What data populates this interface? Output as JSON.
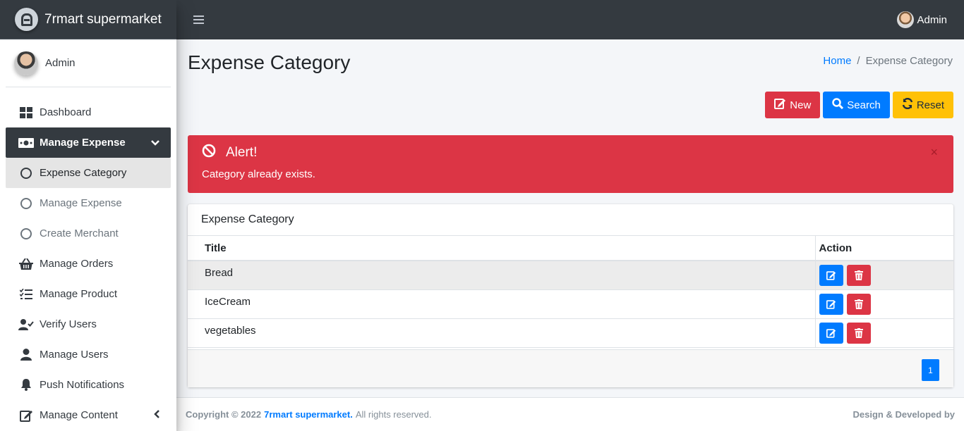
{
  "brand": {
    "name": "7rmart supermarket"
  },
  "user": {
    "name": "Admin"
  },
  "topbar": {
    "user_name": "Admin"
  },
  "sidebar": {
    "items": [
      {
        "label": "Dashboard",
        "icon": "dashboard-icon"
      },
      {
        "label": "Manage Expense",
        "icon": "money-bill-icon",
        "active": true
      },
      {
        "label": "Expense Category",
        "icon": "circle-icon",
        "sub": true,
        "current": true
      },
      {
        "label": "Manage Expense",
        "icon": "circle-icon",
        "sub": true
      },
      {
        "label": "Create Merchant",
        "icon": "circle-icon",
        "sub": true
      },
      {
        "label": "Manage Orders",
        "icon": "basket-icon"
      },
      {
        "label": "Manage Product",
        "icon": "tasks-icon"
      },
      {
        "label": "Verify Users",
        "icon": "user-check-icon"
      },
      {
        "label": "Manage Users",
        "icon": "user-icon"
      },
      {
        "label": "Push Notifications",
        "icon": "bell-icon"
      },
      {
        "label": "Manage Content",
        "icon": "edit-icon"
      }
    ]
  },
  "page": {
    "title": "Expense Category"
  },
  "breadcrumb": {
    "home": "Home",
    "separator": "/",
    "current": "Expense Category"
  },
  "actions": {
    "new_label": "New",
    "search_label": "Search",
    "reset_label": "Reset"
  },
  "alert": {
    "title": "Alert!",
    "message": "Category already exists.",
    "close": "×"
  },
  "card": {
    "title": "Expense Category",
    "columns": [
      "Title",
      "Action"
    ],
    "rows": [
      "Bread",
      "IceCream",
      "vegetables"
    ],
    "page": "1"
  },
  "footer": {
    "copyright": "Copyright © 2022",
    "brand": "7rmart supermarket.",
    "rights": "All rights reserved.",
    "credit": "Design & Developed by"
  },
  "colors": {
    "dark": "#343a40",
    "primary": "#007bff",
    "danger": "#dc3545",
    "warning": "#ffc107"
  }
}
